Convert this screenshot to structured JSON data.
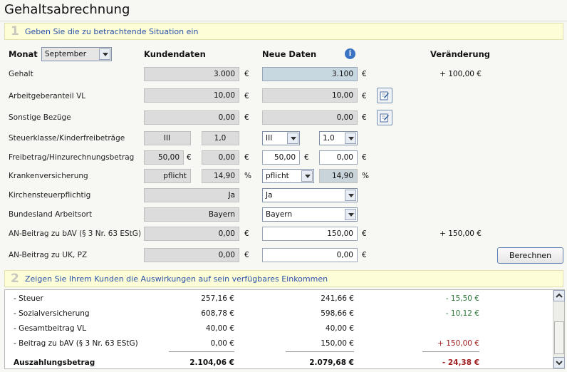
{
  "title": "Gehaltsabrechnung",
  "step1": {
    "num": "1",
    "text": "Geben Sie die zu betrachtende Situation ein"
  },
  "step2": {
    "num": "2",
    "text": "Zeigen Sie Ihrem Kunden die Auswirkungen auf sein verfügbares Einkommen"
  },
  "header": {
    "monat_label": "Monat",
    "monat_value": "September",
    "kundendaten": "Kundendaten",
    "neue_daten": "Neue Daten",
    "veraenderung": "Veränderung"
  },
  "rows": {
    "gehalt": {
      "label": "Gehalt",
      "kunde": "3.000",
      "neu": "3.100",
      "unit": "€",
      "change": "+ 100,00 €"
    },
    "vl": {
      "label": "Arbeitgeberanteil VL",
      "kunde": "10,00",
      "neu": "10,00",
      "unit": "€"
    },
    "sonstige": {
      "label": "Sonstige Bezüge",
      "kunde": "0,00",
      "neu": "0,00",
      "unit": "€"
    },
    "steuerklasse": {
      "label": "Steuerklasse/Kinderfreibeträge",
      "kunde_klasse": "III",
      "kunde_kinder": "1,0",
      "neu_klasse": "III",
      "neu_kinder": "1,0"
    },
    "freibetrag": {
      "label": "Freibetrag/Hinzurechnungsbetrag",
      "kunde_a": "50,00",
      "kunde_b": "0,00",
      "neu_a": "50,00",
      "neu_b": "0,00",
      "unit": "€"
    },
    "kv": {
      "label": "Krankenversicherung",
      "kunde_art": "pflicht",
      "kunde_satz": "14,90",
      "neu_art": "pflicht",
      "neu_satz": "14,90",
      "unit": "%"
    },
    "kirche": {
      "label": "Kirchensteuerpflichtig",
      "kunde": "Ja",
      "neu": "Ja"
    },
    "bundesland": {
      "label": "Bundesland Arbeitsort",
      "kunde": "Bayern",
      "neu": "Bayern"
    },
    "bav": {
      "label": "AN-Beitrag zu bAV (§ 3 Nr. 63 EStG)",
      "kunde": "0,00",
      "neu": "150,00",
      "unit": "€",
      "change": "+ 150,00 €"
    },
    "uk": {
      "label": "AN-Beitrag zu UK, PZ",
      "kunde": "0,00",
      "neu": "0,00",
      "unit": "€"
    }
  },
  "berechnen": "Berechnen",
  "results": [
    {
      "label": "- Steuer",
      "kunde": "257,16 €",
      "neu": "241,66 €",
      "change": "- 15,50 €",
      "color": "#2e7a3a"
    },
    {
      "label": "- Sozialversicherung",
      "kunde": "608,78 €",
      "neu": "598,66 €",
      "change": "- 10,12 €",
      "color": "#2e7a3a"
    },
    {
      "label": "- Gesamtbeitrag VL",
      "kunde": "40,00 €",
      "neu": "40,00 €",
      "change": "",
      "color": "#111111"
    },
    {
      "label": "- Beitrag zu bAV (§ 3 Nr. 63 EStG)",
      "kunde": "0,00 €",
      "neu": "150,00 €",
      "change": "+ 150,00 €",
      "color": "#a02020"
    }
  ],
  "total": {
    "label": "Auszahlungsbetrag",
    "kunde": "2.104,06 €",
    "neu": "2.079,68 €",
    "change": "- 24,38 €"
  }
}
